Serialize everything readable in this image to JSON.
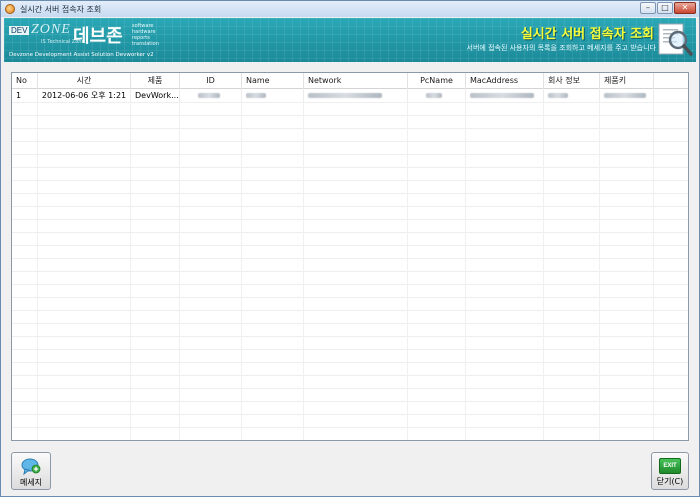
{
  "window": {
    "title": "실시간 서버 접속자 조회",
    "controls": {
      "minimize": "–",
      "maximize": "□",
      "close": "✕"
    }
  },
  "banner": {
    "logo_dev": "DEV",
    "logo_zone": "ZONE",
    "logo_sub": "IS Technical Zone",
    "logo_korean": "데브존",
    "logo_words": [
      "software",
      "hardware",
      "reports",
      "translation"
    ],
    "caption": "Devzone Development Assist Solution Devworker v2",
    "title": "실시간 서버 접속자 조회",
    "description": "서버에 접속된 사용자의 목록을 조회하고 메세지를 주고 받습니다",
    "icon": "magnifier-document-icon"
  },
  "grid": {
    "columns": [
      "No",
      "시간",
      "제품",
      "ID",
      "Name",
      "Network",
      "PcName",
      "MacAddress",
      "회사 정보",
      "제품키"
    ],
    "rows": [
      {
        "no": "1",
        "time": "2012-06-06 오후 1:21",
        "product": "DevWork...",
        "id": "",
        "name": "",
        "network": "",
        "pcname": "",
        "mac": "",
        "company": "",
        "product_key": ""
      }
    ]
  },
  "buttons": {
    "message_label": "메세지",
    "message_icon": "chat-bubble-add-icon",
    "close_label": "닫기(C)",
    "close_icon_text": "EXIT"
  },
  "colors": {
    "banner": "#1f97a6",
    "banner_title": "#f6ff3a"
  }
}
